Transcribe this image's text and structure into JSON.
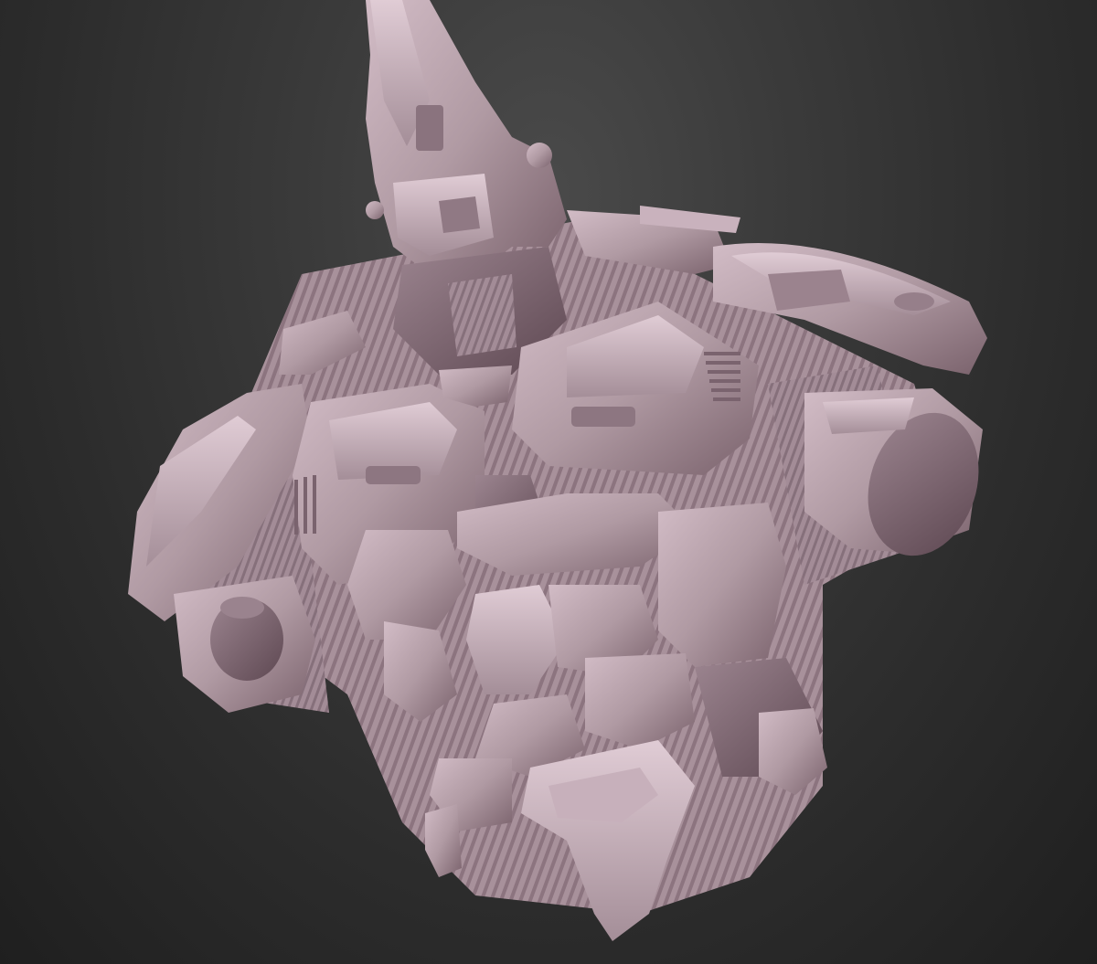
{
  "scene": {
    "subject": "armored-sculpt",
    "material_color": "#b49aa4",
    "shadow_color": "#6e5560",
    "highlight_color": "#dcc6d0",
    "background_top": "#4a4a4a",
    "background_bottom": "#1f1f1f"
  }
}
